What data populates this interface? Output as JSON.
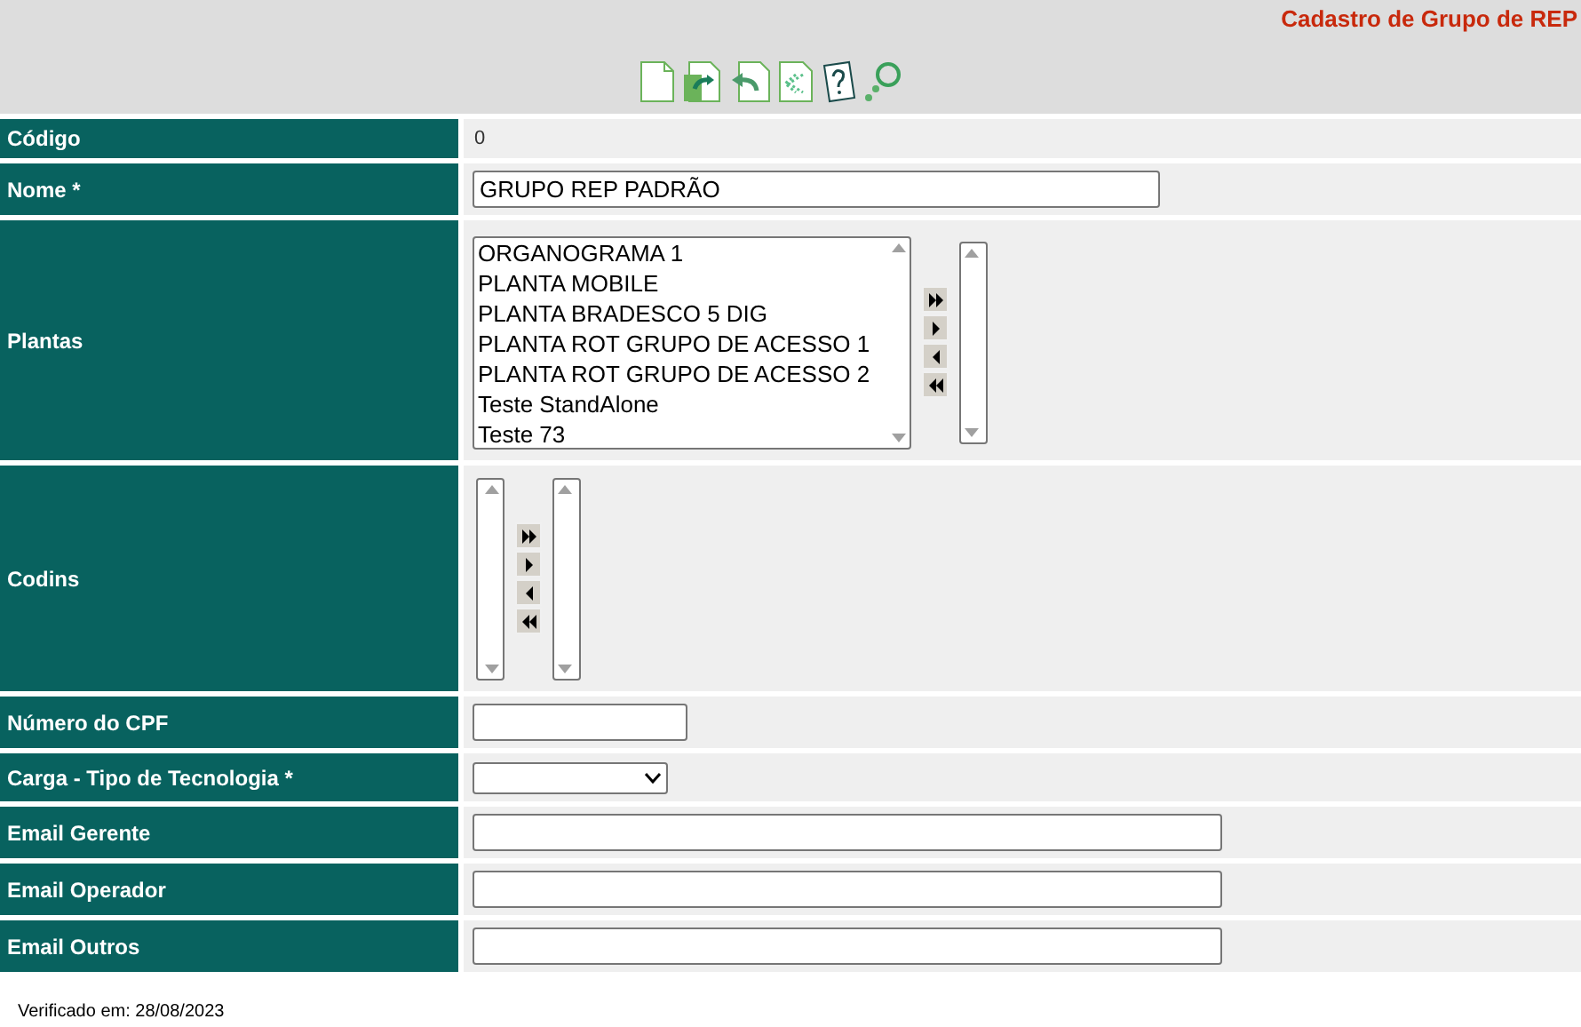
{
  "header": {
    "title": "Cadastro de Grupo de REP"
  },
  "fields": [
    {
      "kind": "static",
      "label": "Código",
      "value": "0"
    },
    {
      "kind": "input",
      "label": "Nome *",
      "value": "GRUPO REP PADRÃO"
    },
    {
      "kind": "duallist",
      "label": "Plantas",
      "options": [
        {
          "text": "ORGANOGRAMA 1",
          "selected": false
        },
        {
          "text": "PLANTA MOBILE",
          "selected": false
        },
        {
          "text": "PLANTA BRADESCO 5 DIG",
          "selected": false
        },
        {
          "text": "PLANTA ROT GRUPO DE ACESSO 1",
          "selected": false
        },
        {
          "text": "PLANTA ROT GRUPO DE ACESSO 2",
          "selected": false
        },
        {
          "text": "Teste StandAlone",
          "selected": false
        },
        {
          "text": "Teste 73",
          "selected": false
        }
      ]
    },
    {
      "kind": "duallist",
      "label": "Codins"
    },
    {
      "kind": "input",
      "label": "Número do CPF"
    },
    {
      "kind": "select",
      "label": "Carga - Tipo de Tecnologia *"
    },
    {
      "kind": "input",
      "label": "Email Gerente"
    },
    {
      "kind": "input",
      "label": "Email Operador"
    },
    {
      "kind": "input",
      "label": "Email Outros"
    }
  ],
  "footer": {
    "verified": "Verificado em: 28/08/2023"
  }
}
